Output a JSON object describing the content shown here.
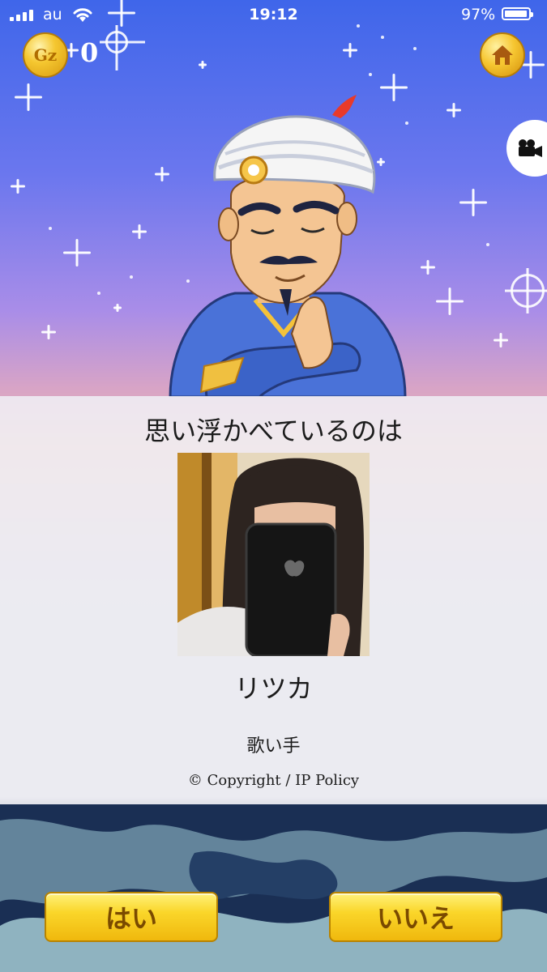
{
  "status_bar": {
    "carrier": "au",
    "time": "19:12",
    "battery_percent": "97%",
    "battery_level": 0.97
  },
  "header": {
    "coin_symbol": "Gz",
    "coin_count": "0",
    "home_icon": "home-icon",
    "video_icon": "video-camera-icon"
  },
  "card": {
    "title": "思い浮かべているのは",
    "character_name": "リツカ",
    "character_description": "歌い手",
    "copyright": "© Copyright / IP Policy"
  },
  "buttons": {
    "yes_label": "はい",
    "no_label": "いいえ"
  },
  "colors": {
    "sky_top": "#3f66ea",
    "sky_bottom": "#ecb8b0",
    "button_gold": "#fad62a",
    "button_text": "#7a4a00"
  }
}
